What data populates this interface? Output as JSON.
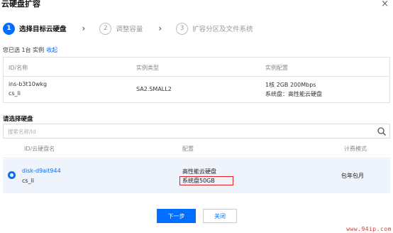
{
  "dialog": {
    "title": "云硬盘扩容",
    "close": "×"
  },
  "steps": [
    {
      "num": "1",
      "label": "选择目标云硬盘"
    },
    {
      "num": "2",
      "label": "调整容量"
    },
    {
      "num": "3",
      "label": "扩容分区及文件系统"
    }
  ],
  "step_arrow": "›",
  "selected": {
    "prefix": "您已选 1台 实例",
    "collapse_link": "收起"
  },
  "instance_table": {
    "headers": [
      "ID/名称",
      "实例类型",
      "实例配置"
    ],
    "row": {
      "id": "ins-b3t10wkg",
      "name": "cs_li",
      "type": "SA2.SMALL2",
      "config_line1": "1核 2GB 200Mbps",
      "config_line2": "系统盘：高性能云硬盘"
    }
  },
  "disk_section": {
    "title": "请选择硬盘",
    "search_placeholder": "搜索名称/Id",
    "headers": [
      "ID/云硬盘名",
      "配置",
      "计费模式"
    ],
    "row": {
      "id": "disk-d9ait944",
      "name": "cs_li",
      "config_line1": "高性能云硬盘",
      "config_line2": "系统盘50GB",
      "billing": "包年包月"
    }
  },
  "buttons": {
    "next": "下一步",
    "close": "关闭"
  },
  "watermark": "www.94ip.com",
  "colors": {
    "accent": "#006eff",
    "highlight_box": "#e02020",
    "selected_row_bg": "#eef3fc"
  }
}
